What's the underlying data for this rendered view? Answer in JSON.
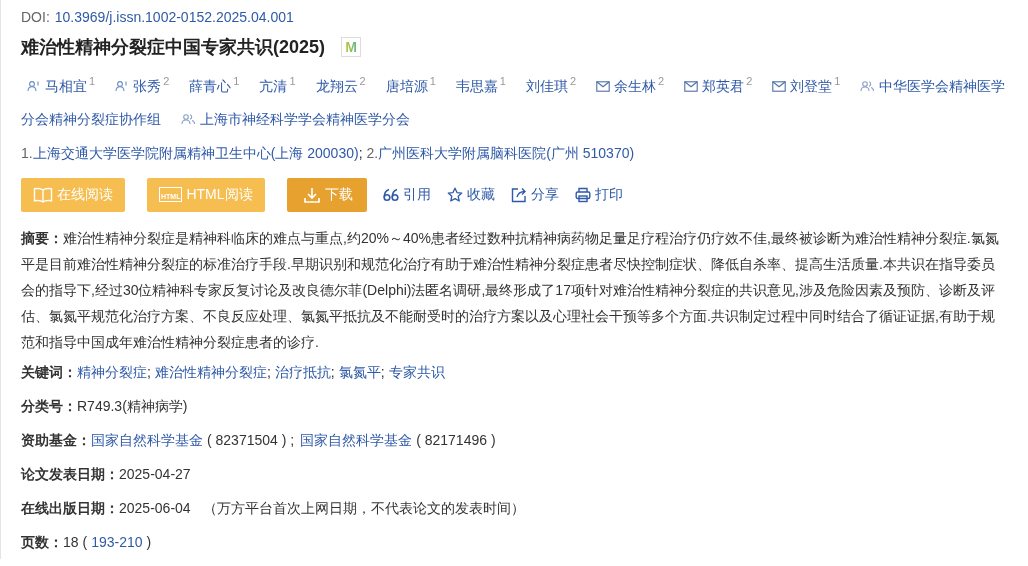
{
  "doi": {
    "label": "DOI:",
    "value": "10.3969/j.issn.1002-0152.2025.04.001"
  },
  "title": {
    "text": "难治性精神分裂症中国专家共识(2025)",
    "badge": "M"
  },
  "authors": [
    {
      "name": "马相宜",
      "sup": "1",
      "kind": "person"
    },
    {
      "name": "张秀",
      "sup": "2",
      "kind": "person"
    },
    {
      "name": "薛青心",
      "sup": "1",
      "kind": "plain"
    },
    {
      "name": "亢清",
      "sup": "1",
      "kind": "plain"
    },
    {
      "name": "龙翔云",
      "sup": "2",
      "kind": "plain"
    },
    {
      "name": "唐培源",
      "sup": "1",
      "kind": "plain"
    },
    {
      "name": "韦思嘉",
      "sup": "1",
      "kind": "plain"
    },
    {
      "name": "刘佳琪",
      "sup": "2",
      "kind": "plain"
    },
    {
      "name": "余生林",
      "sup": "2",
      "kind": "mail"
    },
    {
      "name": "郑英君",
      "sup": "2",
      "kind": "mail"
    },
    {
      "name": "刘登堂",
      "sup": "1",
      "kind": "mail"
    },
    {
      "name_lines": [
        "中华医学会精神医学",
        "分会精神分裂症协作组"
      ],
      "kind": "group"
    },
    {
      "name": "上海市神经科学学会精神医学分会",
      "kind": "group"
    }
  ],
  "affiliations": [
    {
      "number": "1.",
      "name": "上海交通大学医学院附属精神卫生中心(上海 200030)",
      "separator": ";"
    },
    {
      "number": "2.",
      "name": "广州医科大学附属脑科医院(广州 510370)"
    }
  ],
  "buttons": [
    {
      "label": "在线阅读",
      "kind": "read"
    },
    {
      "label": "HTML阅读",
      "kind": "html",
      "icon_text": "HTML"
    },
    {
      "label": "下载",
      "kind": "download"
    }
  ],
  "actions": [
    {
      "label": "引用",
      "kind": "cite"
    },
    {
      "label": "收藏",
      "kind": "star"
    },
    {
      "label": "分享",
      "kind": "share"
    },
    {
      "label": "打印",
      "kind": "print"
    }
  ],
  "abstract": {
    "text": "**摘要：**难治性精神分裂症是精神科临床的难点与重点,约20%～40%患者经过数种抗精神病药物足量足疗程治疗仍疗效不佳,最终被诊断为难治性精神分裂症.氯氮平是目前难治性精神分裂症的标准治疗手段.早期识别和规范化治疗有助于难治性精神分裂症患者尽快控制症状、降低自杀率、提高生活质量.本共识在指导委员会的指导下,经过30位精神科专家反复讨论及改良德尔菲(Delphi)法匿名调研,最终形成了17项针对难治性精神分裂症的共识意见,涉及危险因素及预防、诊断及评估、氯氮平规范化治疗方案、不良反应处理、氯氮平抵抗及不能耐受时的治疗方案以及心理社会干预等多个方面.共识制定过程中同时结合了循证证据,有助于规范和指导中国成年难治性精神分裂症患者的诊疗."
  },
  "keywords": {
    "label": "关键词：",
    "items": [
      "精神分裂症",
      "难治性精神分裂症",
      "治疗抵抗",
      "氯氮平",
      "专家共识"
    ],
    "separator": ";"
  },
  "classification": {
    "label": "分类号：",
    "value": "R749.3(精神病学)"
  },
  "funding": {
    "label": "资助基金：",
    "items": [
      {
        "name": "国家自然科学基金",
        "code": "( 82371504 ) ;"
      },
      {
        "name": "国家自然科学基金",
        "code": "( 82171496 )"
      }
    ]
  },
  "published": {
    "label": "论文发表日期：",
    "value": "2025-04-27"
  },
  "online": {
    "label": "在线出版日期：",
    "value": "2025-06-04",
    "note": "（万方平台首次上网日期，不代表论文的发表时间）"
  },
  "pages": {
    "label": "页数：",
    "count": "18 (",
    "range": "193-210",
    "close": ")"
  }
}
